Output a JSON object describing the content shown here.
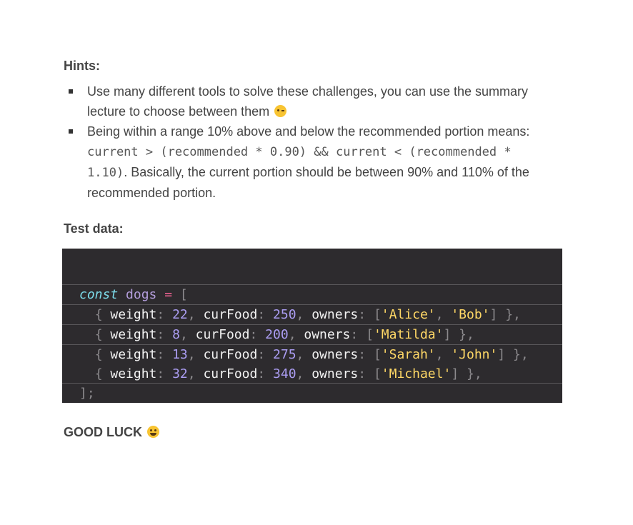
{
  "hints": {
    "title": "Hints:",
    "items": [
      {
        "text": "Use many different tools to solve these challenges, you can use the summary lecture to choose between them",
        "emoji": "winking-face"
      },
      {
        "text_before": "Being within a range 10% above and below the recommended portion means:",
        "code_line_1": "current > (recommended * 0.90) && current < (recommended *",
        "code_line_2": "1.10)",
        "text_after": ". Basically, the current portion should be between 90% and 110% of the",
        "text_last": "recommended portion."
      }
    ]
  },
  "test_data": {
    "title": "Test data:",
    "code": {
      "line0": {
        "kw": "const",
        "var": "dogs",
        "op": "=",
        "open": "["
      },
      "rows": [
        {
          "weight": "22",
          "curFood": "250",
          "owners": [
            "'Alice'",
            "'Bob'"
          ]
        },
        {
          "weight": "8",
          "curFood": "200",
          "owners": [
            "'Matilda'"
          ]
        },
        {
          "weight": "13",
          "curFood": "275",
          "owners": [
            "'Sarah'",
            "'John'"
          ]
        },
        {
          "weight": "32",
          "curFood": "340",
          "owners": [
            "'Michael'"
          ]
        }
      ],
      "close": "];"
    }
  },
  "footer": {
    "good_luck": "GOOD LUCK",
    "emoji": "grinning-face"
  }
}
